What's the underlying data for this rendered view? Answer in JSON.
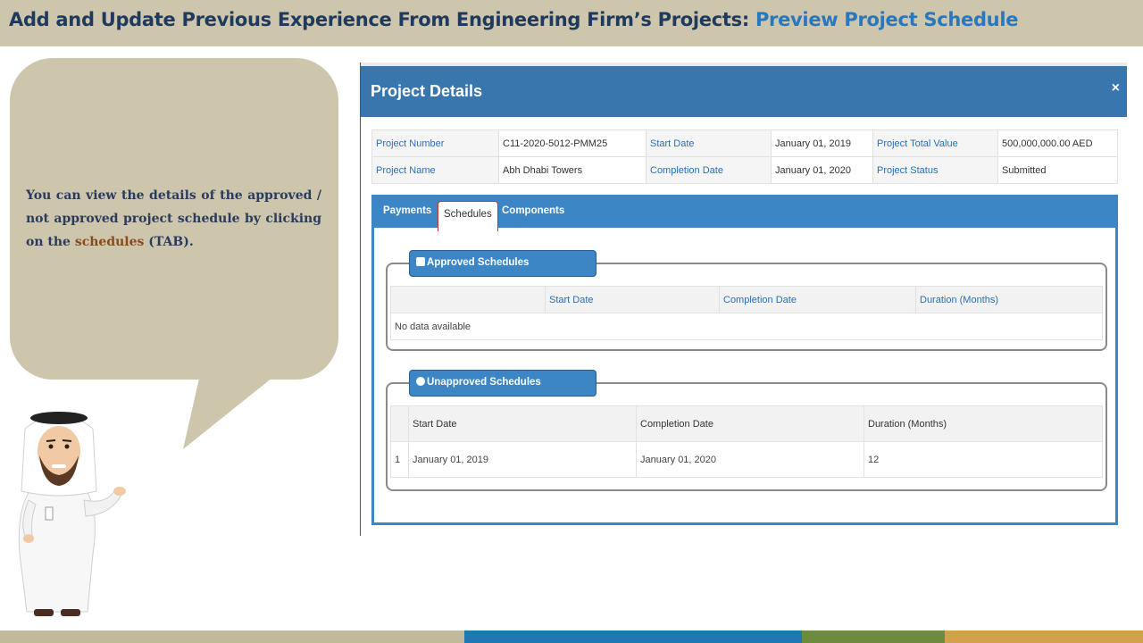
{
  "slide": {
    "title_main": "Add and Update Previous Experience From Engineering Firm’s Projects: ",
    "title_accent": "Preview Project Schedule",
    "bubble": {
      "text_before": "You can view the details of  the approved / not approved project schedule by clicking on the ",
      "highlight": "schedules",
      "text_after": " (TAB)."
    },
    "footer_colors": [
      "#c2b89a",
      "#1f78b4",
      "#6e8b3d",
      "#d3a04c"
    ]
  },
  "modal": {
    "title": "Project Details",
    "close_label": "×",
    "info": {
      "project_number_label": "Project Number",
      "project_number": "C11-2020-5012-PMM25",
      "start_date_label": "Start Date",
      "start_date": "January 01, 2019",
      "total_value_label": "Project Total Value",
      "total_value": "500,000,000.00 AED",
      "project_name_label": "Project Name",
      "project_name": "Abh Dhabi Towers",
      "completion_date_label": "Completion Date",
      "completion_date": "January 01, 2020",
      "status_label": "Project Status",
      "status": "Submitted"
    },
    "tabs": [
      {
        "label": "Payments"
      },
      {
        "label": "Schedules"
      },
      {
        "label": "Components"
      }
    ],
    "approved": {
      "legend": "Approved Schedules",
      "columns": [
        "",
        "Start Date",
        "Completion Date",
        "Duration (Months)"
      ],
      "empty_text": "No data available"
    },
    "unapproved": {
      "legend": "Unapproved Schedules",
      "columns": [
        "",
        "Start Date",
        "Completion Date",
        "Duration (Months)"
      ],
      "rows": [
        {
          "index": "1",
          "start": "January 01, 2019",
          "completion": "January 01, 2020",
          "duration": "12"
        }
      ]
    }
  },
  "colors": {
    "header_bg": "#cdc6ac",
    "title_color": "#1f3a5f",
    "accent": "#2878c0",
    "modal_header": "#3a76ae",
    "tab_strip": "#3d86c6"
  }
}
